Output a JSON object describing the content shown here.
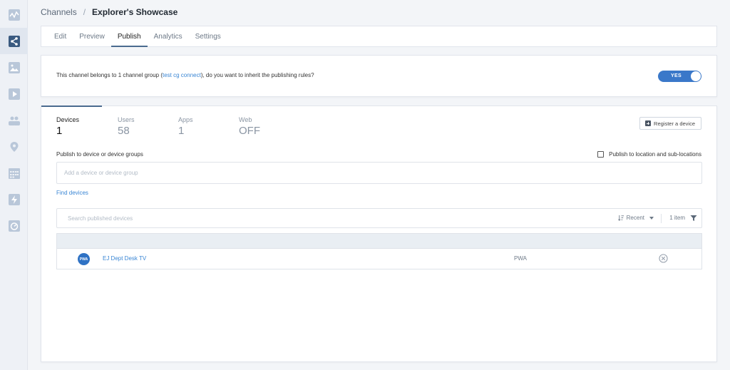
{
  "breadcrumb": {
    "root": "Channels",
    "separator": "/",
    "current": "Explorer's Showcase"
  },
  "tabs": [
    {
      "label": "Edit"
    },
    {
      "label": "Preview"
    },
    {
      "label": "Publish"
    },
    {
      "label": "Analytics"
    },
    {
      "label": "Settings"
    }
  ],
  "active_tab": "Publish",
  "inherit": {
    "text_before": "This channel belongs to 1 channel group (",
    "link": "test cg connect",
    "text_after": "), do you want to inherit the publishing rules?",
    "toggle_label": "YES",
    "toggle_on": true
  },
  "stats": [
    {
      "label": "Devices",
      "value": "1"
    },
    {
      "label": "Users",
      "value": "58"
    },
    {
      "label": "Apps",
      "value": "1"
    },
    {
      "label": "Web",
      "value": "OFF"
    }
  ],
  "register_button": "Register a device",
  "publish_label": "Publish to device or device groups",
  "location_checkbox": {
    "label": "Publish to location and sub-locations",
    "checked": false
  },
  "device_input": {
    "placeholder": "Add a device or device group",
    "value": ""
  },
  "find_devices": "Find devices",
  "search": {
    "placeholder": "Search published devices",
    "sort_label": "Recent",
    "count": "1 item"
  },
  "devices": [
    {
      "badge": "PWA",
      "name": "EJ Dept Desk TV",
      "type": "PWA"
    }
  ],
  "colors": {
    "accent": "#3a78c9",
    "link": "#3a86d4",
    "nav_active": "#3a5a80"
  },
  "sidebar_icons": [
    "activity-icon",
    "share-icon",
    "image-icon",
    "play-icon",
    "users-icon",
    "location-pin-icon",
    "calendar-icon",
    "lightning-icon",
    "gauge-icon"
  ]
}
